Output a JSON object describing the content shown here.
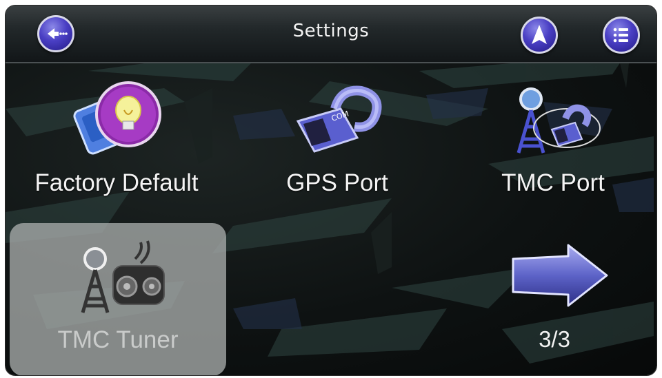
{
  "header": {
    "title": "Settings",
    "back_icon": "back-arrow-icon",
    "navigate_icon": "navigation-arrow-icon",
    "menu_icon": "list-menu-icon"
  },
  "tiles": [
    {
      "label": "Factory Default",
      "icon": "factory-default-lightbulb-icon",
      "selected": false
    },
    {
      "label": "GPS Port",
      "icon": "com-port-plug-icon",
      "selected": false
    },
    {
      "label": "TMC Port",
      "icon": "tmc-antenna-plug-icon",
      "selected": false
    },
    {
      "label": "TMC Tuner",
      "icon": "tmc-antenna-radio-icon",
      "selected": true
    }
  ],
  "pager": {
    "next_icon": "next-page-arrow-icon",
    "page_indicator": "3/3",
    "current_page": 3,
    "total_pages": 3
  },
  "icon_text": {
    "com_label": "COM"
  },
  "colors": {
    "button_blue": "#4a3fc4",
    "arrow_blue": "#5d63c8",
    "selected_tile": "#a8acaa",
    "background": "#0e1212"
  }
}
